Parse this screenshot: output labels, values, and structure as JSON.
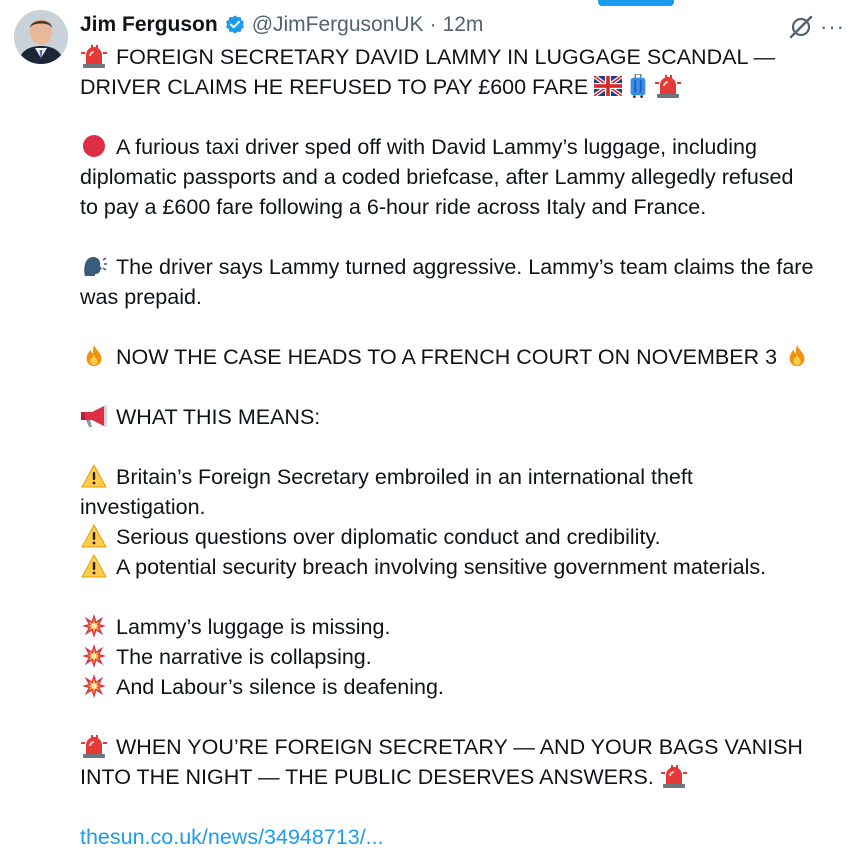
{
  "post": {
    "author_name": "Jim Ferguson",
    "handle": "@JimFergusonUK",
    "separator": "·",
    "timestamp": "12m",
    "more_label": "···"
  },
  "body": {
    "headline_line1": "FOREIGN SECRETARY DAVID LAMMY IN LUGGAGE SCANDAL —",
    "headline_line2": "DRIVER CLAIMS HE REFUSED TO PAY £600 FARE",
    "p1_line1": "A furious taxi driver sped off with David Lammy’s luggage, including",
    "p1_line2": "diplomatic passports and a coded briefcase, after Lammy allegedly refused",
    "p1_line3": "to pay a £600 fare following a 6-hour ride across Italy and France.",
    "p2_line1": "The driver says Lammy turned aggressive. Lammy’s team claims the fare",
    "p2_line2": "was prepaid.",
    "court_line": "NOW THE CASE HEADS TO A FRENCH COURT ON NOVEMBER 3",
    "means_heading": "WHAT THIS MEANS:",
    "warn1_line1": "Britain’s Foreign Secretary embroiled in an international theft",
    "warn1_line2": "investigation.",
    "warn2": "Serious questions over diplomatic conduct and credibility.",
    "warn3": "A potential security breach involving sensitive government materials.",
    "boom1": "Lammy’s luggage is missing.",
    "boom2": "The narrative is collapsing.",
    "boom3": "And Labour’s silence is deafening.",
    "closing_line1": "WHEN YOU’RE FOREIGN SECRETARY — AND YOUR BAGS VANISH",
    "closing_line2": "INTO THE NIGHT — THE PUBLIC DESERVES ANSWERS.",
    "link_text": "thesun.co.uk/news/34948713/..."
  },
  "icons": {
    "verified": "verified-badge-icon",
    "siren": "police-light-icon",
    "flag": "uk-flag-icon",
    "luggage": "luggage-icon",
    "red_circle": "red-circle-icon",
    "speaking_head": "speaking-head-icon",
    "fire": "fire-icon",
    "megaphone": "megaphone-icon",
    "warning": "warning-icon",
    "collision": "collision-icon",
    "grok": "grok-icon",
    "more": "more-icon"
  },
  "colors": {
    "link": "#1d9bf0",
    "secondary_text": "#536471",
    "verified": "#1d9bf0"
  }
}
